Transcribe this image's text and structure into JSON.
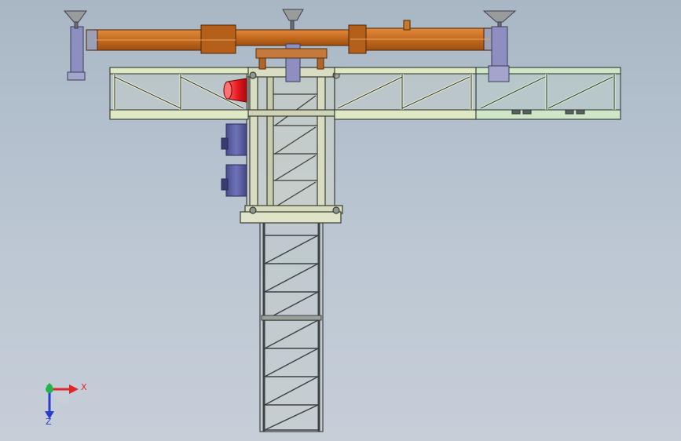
{
  "view": {
    "background_top": "#a9b7c5",
    "background_bottom": "#c6ced8"
  },
  "model": {
    "jib_color": "#c46a1e",
    "walkway_color": "#dfe8c4",
    "walkway_right_color": "#cfe7c8",
    "mast_color": "#4a4d50",
    "cage_color": "#d8dcc0",
    "cylinder_color": "#e0141c",
    "motor_color": "#5f63a8",
    "post_color": "#8d8fc0"
  },
  "triad": {
    "x_label": "X",
    "z_label": "Z",
    "x_color": "#e0262b",
    "z_color": "#2a3bd1",
    "y_color": "#27b34a",
    "icons": [
      "x-axis-arrow-icon",
      "z-axis-arrow-icon",
      "y-axis-origin-icon"
    ]
  }
}
